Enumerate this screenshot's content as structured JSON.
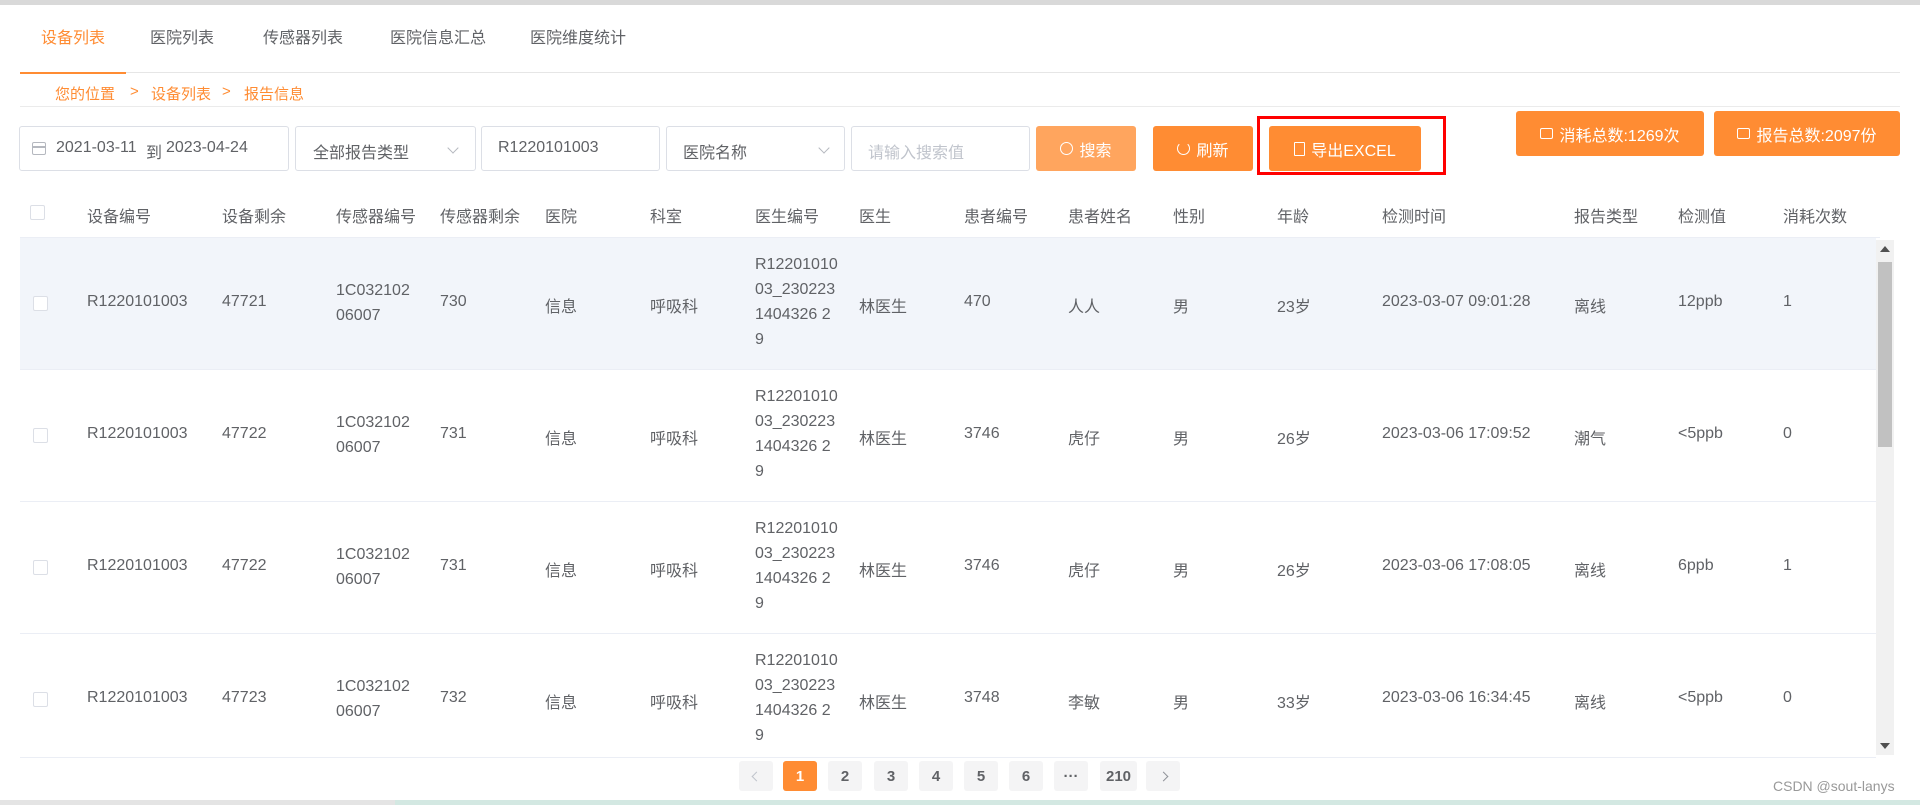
{
  "tabs": [
    {
      "label": "设备列表",
      "active": true
    },
    {
      "label": "医院列表"
    },
    {
      "label": "传感器列表"
    },
    {
      "label": "医院信息汇总"
    },
    {
      "label": "医院维度统计"
    }
  ],
  "breadcrumb": {
    "home": "您的位置",
    "sep": ">",
    "level1": "设备列表",
    "level2": "报告信息"
  },
  "filters": {
    "date_start": "2021-03-11",
    "date_to": "到",
    "date_end": "2023-04-24",
    "report_type": "全部报告类型",
    "device_id": "R1220101003",
    "hospital": "医院名称",
    "search_placeholder": "请输入搜索值"
  },
  "buttons": {
    "search": "搜索",
    "refresh": "刷新",
    "export": "导出EXCEL",
    "consumption_total": "消耗总数:1269次",
    "report_total": "报告总数:2097份"
  },
  "colors": {
    "accent": "#ff8c33",
    "highlight_box": "#ff0000"
  },
  "table": {
    "headers": [
      "设备编号",
      "设备剩余",
      "传感器编号",
      "传感器剩余",
      "医院",
      "科室",
      "医生编号",
      "医生",
      "患者编号",
      "患者姓名",
      "性别",
      "年龄",
      "检测时间",
      "报告类型",
      "检测值",
      "消耗次数"
    ],
    "rows": [
      [
        "R1220101003",
        "47721",
        "1C03210206007",
        "730",
        "信息",
        "呼吸科",
        "R1220101003_2302231404326 29",
        "林医生",
        "470",
        "人人",
        "男",
        "23岁",
        "2023-03-07 09:01:28",
        "离线",
        "12ppb",
        "1"
      ],
      [
        "R1220101003",
        "47722",
        "1C03210206007",
        "731",
        "信息",
        "呼吸科",
        "R1220101003_2302231404326 29",
        "林医生",
        "3746",
        "虎仔",
        "男",
        "26岁",
        "2023-03-06 17:09:52",
        "潮气",
        "<5ppb",
        "0"
      ],
      [
        "R1220101003",
        "47722",
        "1C03210206007",
        "731",
        "信息",
        "呼吸科",
        "R1220101003_2302231404326 29",
        "林医生",
        "3746",
        "虎仔",
        "男",
        "26岁",
        "2023-03-06 17:08:05",
        "离线",
        "6ppb",
        "1"
      ],
      [
        "R1220101003",
        "47723",
        "1C03210206007",
        "732",
        "信息",
        "呼吸科",
        "R1220101003_2302231404326 29",
        "林医生",
        "3748",
        "李敏",
        "男",
        "33岁",
        "2023-03-06 16:34:45",
        "离线",
        "<5ppb",
        "0"
      ]
    ]
  },
  "pagination": {
    "pages": [
      "1",
      "2",
      "3",
      "4",
      "5",
      "6",
      "···",
      "210"
    ],
    "current": "1"
  },
  "watermark": "CSDN @sout-lanys"
}
